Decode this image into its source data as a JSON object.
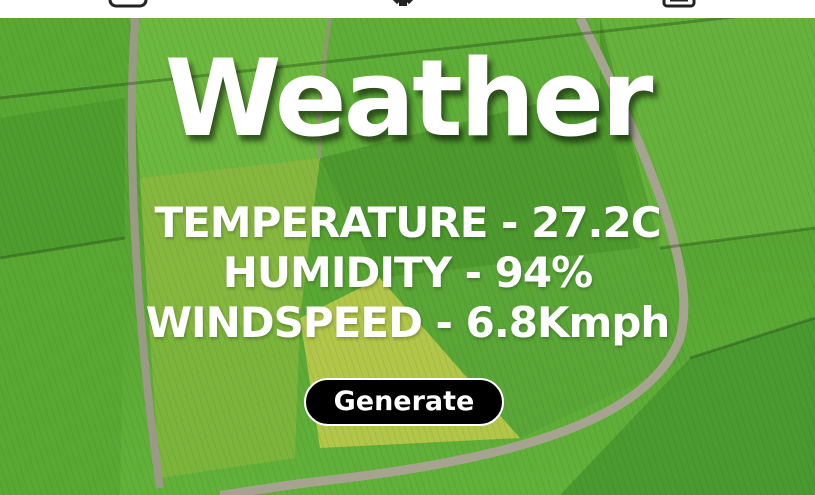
{
  "header": {
    "icons": [
      "square-icon",
      "person-icon",
      "document-icon"
    ]
  },
  "main": {
    "title": "Weather",
    "stats": [
      {
        "label": "TEMPERATURE - 27.2C"
      },
      {
        "label": "HUMIDITY - 94%"
      },
      {
        "label": "WINDSPEED - 6.8Kmph"
      }
    ],
    "generate_label": "Generate"
  },
  "colors": {
    "text": "#ffffff",
    "button_bg": "#000000",
    "field_green": "#5aa632"
  }
}
